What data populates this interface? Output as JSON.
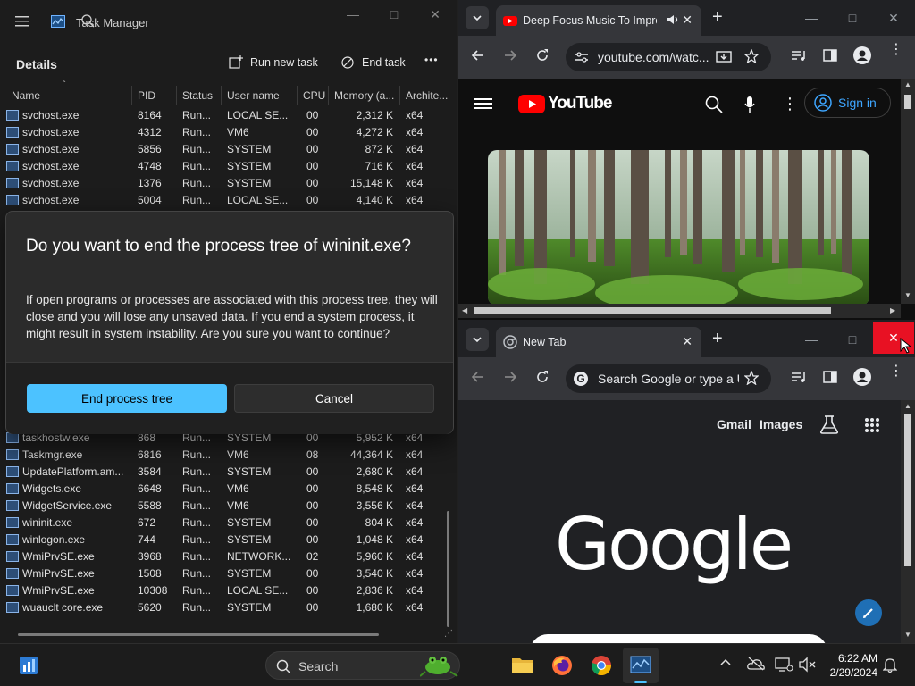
{
  "task_manager": {
    "title": "Task Manager",
    "section": "Details",
    "run_new_task": "Run new task",
    "end_task": "End task",
    "more": "•••",
    "columns": [
      "Name",
      "PID",
      "Status",
      "User name",
      "CPU",
      "Memory (a...",
      "Archite..."
    ],
    "rows_top": [
      {
        "name": "svchost.exe",
        "pid": "8164",
        "status": "Run...",
        "user": "LOCAL SE...",
        "cpu": "00",
        "mem": "2,312 K",
        "arch": "x64"
      },
      {
        "name": "svchost.exe",
        "pid": "4312",
        "status": "Run...",
        "user": "VM6",
        "cpu": "00",
        "mem": "4,272 K",
        "arch": "x64"
      },
      {
        "name": "svchost.exe",
        "pid": "5856",
        "status": "Run...",
        "user": "SYSTEM",
        "cpu": "00",
        "mem": "872 K",
        "arch": "x64"
      },
      {
        "name": "svchost.exe",
        "pid": "4748",
        "status": "Run...",
        "user": "SYSTEM",
        "cpu": "00",
        "mem": "716 K",
        "arch": "x64"
      },
      {
        "name": "svchost.exe",
        "pid": "1376",
        "status": "Run...",
        "user": "SYSTEM",
        "cpu": "00",
        "mem": "15,148 K",
        "arch": "x64"
      },
      {
        "name": "svchost.exe",
        "pid": "5004",
        "status": "Run...",
        "user": "LOCAL SE...",
        "cpu": "00",
        "mem": "4,140 K",
        "arch": "x64"
      }
    ],
    "rows_bottom": [
      {
        "name": "taskhostw.exe",
        "pid": "868",
        "status": "Run...",
        "user": "SYSTEM",
        "cpu": "00",
        "mem": "5,952 K",
        "arch": "x64"
      },
      {
        "name": "Taskmgr.exe",
        "pid": "6816",
        "status": "Run...",
        "user": "VM6",
        "cpu": "08",
        "mem": "44,364 K",
        "arch": "x64"
      },
      {
        "name": "UpdatePlatform.am...",
        "pid": "3584",
        "status": "Run...",
        "user": "SYSTEM",
        "cpu": "00",
        "mem": "2,680 K",
        "arch": "x64"
      },
      {
        "name": "Widgets.exe",
        "pid": "6648",
        "status": "Run...",
        "user": "VM6",
        "cpu": "00",
        "mem": "8,548 K",
        "arch": "x64"
      },
      {
        "name": "WidgetService.exe",
        "pid": "5588",
        "status": "Run...",
        "user": "VM6",
        "cpu": "00",
        "mem": "3,556 K",
        "arch": "x64"
      },
      {
        "name": "wininit.exe",
        "pid": "672",
        "status": "Run...",
        "user": "SYSTEM",
        "cpu": "00",
        "mem": "804 K",
        "arch": "x64"
      },
      {
        "name": "winlogon.exe",
        "pid": "744",
        "status": "Run...",
        "user": "SYSTEM",
        "cpu": "00",
        "mem": "1,048 K",
        "arch": "x64"
      },
      {
        "name": "WmiPrvSE.exe",
        "pid": "3968",
        "status": "Run...",
        "user": "NETWORK...",
        "cpu": "02",
        "mem": "5,960 K",
        "arch": "x64"
      },
      {
        "name": "WmiPrvSE.exe",
        "pid": "1508",
        "status": "Run...",
        "user": "SYSTEM",
        "cpu": "00",
        "mem": "3,540 K",
        "arch": "x64"
      },
      {
        "name": "WmiPrvSE.exe",
        "pid": "10308",
        "status": "Run...",
        "user": "LOCAL SE...",
        "cpu": "00",
        "mem": "2,836 K",
        "arch": "x64"
      },
      {
        "name": "wuauclt core.exe",
        "pid": "5620",
        "status": "Run...",
        "user": "SYSTEM",
        "cpu": "00",
        "mem": "1,680 K",
        "arch": "x64"
      }
    ]
  },
  "dialog": {
    "title": "Do you want to end the process tree of wininit.exe?",
    "body": "If open programs or processes are associated with this process tree, they will close and you will lose any unsaved data. If you end a system process, it might result in system instability. Are you sure you want to continue?",
    "primary": "End process tree",
    "secondary": "Cancel"
  },
  "chrome_youtube": {
    "tab_title": "Deep Focus Music To Improve Concentration",
    "url": "youtube.com/watc...",
    "brand": "YouTube",
    "sign_in": "Sign in"
  },
  "chrome_google": {
    "tab_title": "New Tab",
    "omnibox_placeholder": "Search Google or type a URL",
    "gmail": "Gmail",
    "images": "Images",
    "logo": "Google"
  },
  "taskbar": {
    "search": "Search",
    "time": "6:22 AM",
    "date": "2/29/2024"
  },
  "colors": {
    "accent": "#4cc2ff",
    "youtube_red": "#ff0000",
    "close_hover": "#e81123"
  }
}
